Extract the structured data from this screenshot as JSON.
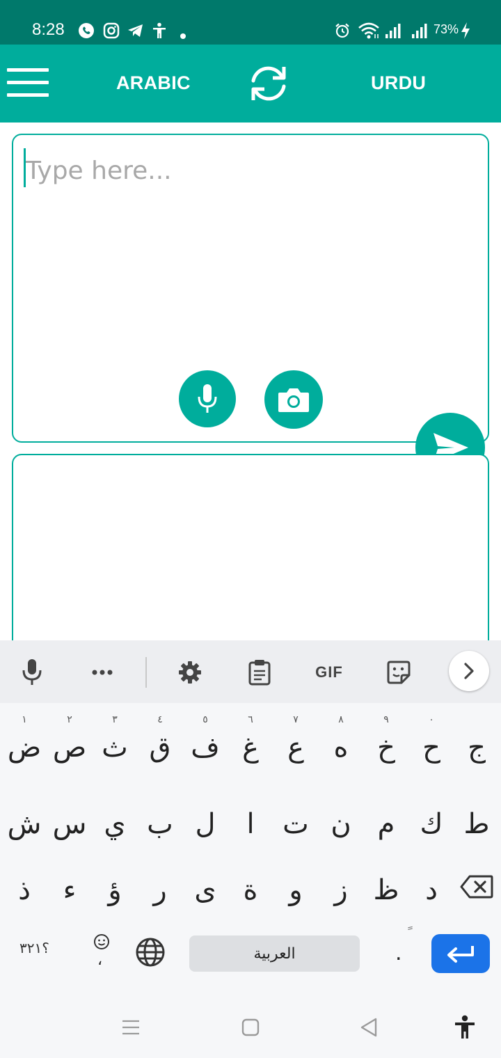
{
  "status_bar": {
    "time": "8:28",
    "battery_percent": "73%",
    "left_icons": [
      "whatsapp-icon",
      "instagram-icon",
      "telegram-icon",
      "accessibility-icon",
      "dot-icon"
    ],
    "right_icons": [
      "alarm-icon",
      "wifi-icon",
      "signal-icon",
      "signal-icon",
      "battery-charging-icon"
    ]
  },
  "app_bar": {
    "menu_icon": "hamburger-menu-icon",
    "source_language": "ARABIC",
    "swap_icon": "swap-languages-icon",
    "target_language": "URDU",
    "background_color": "#00ad9c"
  },
  "input_panel": {
    "placeholder": "Type here...",
    "value": "",
    "mic_icon": "microphone-icon",
    "camera_icon": "camera-icon",
    "send_icon": "send-icon"
  },
  "output_panel": {
    "value": ""
  },
  "keyboard": {
    "toolbar": [
      "microphone-icon",
      "more-icon",
      "settings-icon",
      "clipboard-icon",
      "GIF",
      "sticker-icon",
      "chevron-right-icon"
    ],
    "gif_label": "GIF",
    "row1": [
      {
        "key": "ض",
        "hint": "١"
      },
      {
        "key": "ص",
        "hint": "٢"
      },
      {
        "key": "ث",
        "hint": "٣"
      },
      {
        "key": "ق",
        "hint": "٤"
      },
      {
        "key": "ف",
        "hint": "٥"
      },
      {
        "key": "غ",
        "hint": "٦"
      },
      {
        "key": "ع",
        "hint": "٧"
      },
      {
        "key": "ه",
        "hint": "٨"
      },
      {
        "key": "خ",
        "hint": "٩"
      },
      {
        "key": "ح",
        "hint": "٠"
      },
      {
        "key": "ج",
        "hint": ""
      }
    ],
    "row2": [
      "ش",
      "س",
      "ي",
      "ب",
      "ل",
      "ا",
      "ت",
      "ن",
      "م",
      "ك",
      "ط"
    ],
    "row3": [
      "ذ",
      "ء",
      "ؤ",
      "ر",
      "ى",
      "ة",
      "و",
      "ز",
      "ظ",
      "د"
    ],
    "row4": {
      "numbers_label": "؟٣٢١",
      "comma_label": "،",
      "space_label": "العربية",
      "period_label": ".",
      "period_hint": "ً"
    }
  },
  "nav_bar": [
    "recent-apps-icon",
    "home-icon",
    "back-icon",
    "accessibility-icon"
  ],
  "colors": {
    "status_bar": "#00796b",
    "accent": "#00ad9c",
    "enter_key": "#1b73e8"
  }
}
